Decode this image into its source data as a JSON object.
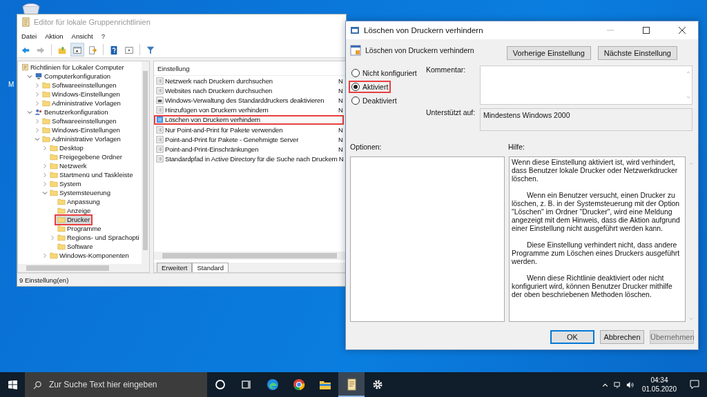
{
  "desktop": {
    "icons": [
      {
        "label": "M"
      }
    ]
  },
  "main_window": {
    "title": "Editor für lokale Gruppenrichtlinien",
    "menu": [
      "Datei",
      "Aktion",
      "Ansicht",
      "?"
    ],
    "toolbar": [
      {
        "kind": "back",
        "disabled": false,
        "selected": false
      },
      {
        "kind": "forward",
        "disabled": true,
        "selected": false
      },
      {
        "kind": "up",
        "disabled": false,
        "selected": false
      },
      {
        "kind": "tree",
        "disabled": false,
        "selected": true
      },
      {
        "kind": "export",
        "disabled": false,
        "selected": false
      },
      {
        "kind": "help",
        "disabled": false,
        "selected": false
      },
      {
        "kind": "pane",
        "disabled": false,
        "selected": false
      },
      {
        "kind": "filter",
        "disabled": false,
        "selected": false
      }
    ],
    "tree": [
      {
        "label": "Richtlinien für Lokaler Computer",
        "kind": "root",
        "selected": false,
        "highlighted": false,
        "children": [
          {
            "label": "Computerkonfiguration",
            "kind": "computer",
            "expanded": true,
            "selected": false,
            "highlighted": false,
            "children": [
              {
                "label": "Softwareeinstellungen",
                "kind": "folder",
                "expanded": false,
                "selected": false,
                "highlighted": false
              },
              {
                "label": "Windows-Einstellungen",
                "kind": "folder",
                "expanded": false,
                "selected": false,
                "highlighted": false
              },
              {
                "label": "Administrative Vorlagen",
                "kind": "folder",
                "expanded": false,
                "selected": false,
                "highlighted": false
              }
            ]
          },
          {
            "label": "Benutzerkonfiguration",
            "kind": "user",
            "expanded": true,
            "selected": false,
            "highlighted": false,
            "children": [
              {
                "label": "Softwareeinstellungen",
                "kind": "folder",
                "expanded": false,
                "selected": false,
                "highlighted": false
              },
              {
                "label": "Windows-Einstellungen",
                "kind": "folder",
                "expanded": false,
                "selected": false,
                "highlighted": false
              },
              {
                "label": "Administrative Vorlagen",
                "kind": "folder",
                "expanded": true,
                "selected": false,
                "highlighted": false,
                "children": [
                  {
                    "label": "Desktop",
                    "kind": "folder",
                    "expanded": false,
                    "selected": false,
                    "highlighted": false
                  },
                  {
                    "label": "Freigegebene Ordner",
                    "kind": "folder",
                    "selected": false,
                    "highlighted": false
                  },
                  {
                    "label": "Netzwerk",
                    "kind": "folder",
                    "expanded": false,
                    "selected": false,
                    "highlighted": false
                  },
                  {
                    "label": "Startmenü und Taskleiste",
                    "kind": "folder",
                    "expanded": false,
                    "selected": false,
                    "highlighted": false
                  },
                  {
                    "label": "System",
                    "kind": "folder",
                    "expanded": false,
                    "selected": false,
                    "highlighted": false
                  },
                  {
                    "label": "Systemsteuerung",
                    "kind": "folder",
                    "expanded": true,
                    "selected": false,
                    "highlighted": false,
                    "children": [
                      {
                        "label": "Anpassung",
                        "kind": "folder",
                        "selected": false,
                        "highlighted": false
                      },
                      {
                        "label": "Anzeige",
                        "kind": "folder",
                        "selected": false,
                        "highlighted": false
                      },
                      {
                        "label": "Drucker",
                        "kind": "folder",
                        "selected": true,
                        "highlighted": true
                      },
                      {
                        "label": "Programme",
                        "kind": "folder",
                        "selected": false,
                        "highlighted": false
                      },
                      {
                        "label": "Regions- und Sprachopti",
                        "kind": "folder",
                        "expanded": false,
                        "selected": false,
                        "highlighted": false
                      },
                      {
                        "label": "Software",
                        "kind": "folder",
                        "selected": false,
                        "highlighted": false
                      }
                    ]
                  },
                  {
                    "label": "Windows-Komponenten",
                    "kind": "folder",
                    "expanded": false,
                    "selected": false,
                    "highlighted": false
                  }
                ]
              }
            ]
          }
        ]
      }
    ],
    "list": {
      "header": "Einstellung",
      "rows": [
        {
          "label": "Netzwerk nach Druckern durchsuchen",
          "state": "N",
          "kind": "setting",
          "highlighted": false
        },
        {
          "label": "Websites nach Druckern durchsuchen",
          "state": "N",
          "kind": "setting",
          "highlighted": false
        },
        {
          "label": "Windows-Verwaltung des Standarddruckers deaktivieren",
          "state": "N",
          "kind": "printer",
          "highlighted": false
        },
        {
          "label": "Hinzufügen von Druckern verhindern",
          "state": "N",
          "kind": "setting",
          "highlighted": false
        },
        {
          "label": "Löschen von Druckern verhindern",
          "kind": "enabled",
          "highlighted": true
        },
        {
          "label": "Nur Point-and-Print für Pakete verwenden",
          "state": "N",
          "kind": "setting",
          "highlighted": false
        },
        {
          "label": "Point-and-Print für Pakete - Genehmigte Server",
          "state": "N",
          "kind": "setting",
          "highlighted": false
        },
        {
          "label": "Point-and-Print-Einschränkungen",
          "state": "N",
          "kind": "setting",
          "highlighted": false
        },
        {
          "label": "Standardpfad in Active Directory für die Suche nach Druckern",
          "state": "N",
          "kind": "setting",
          "highlighted": false
        }
      ]
    },
    "tabs": [
      {
        "label": "Erweitert",
        "selected": false
      },
      {
        "label": "Standard",
        "selected": true
      }
    ],
    "status_bar": "9 Einstellung(en)"
  },
  "dialog": {
    "title": "Löschen von Druckern verhindern",
    "heading": "Löschen von Druckern verhindern",
    "nav_buttons": [
      "Vorherige Einstellung",
      "Nächste Einstellung"
    ],
    "options": [
      {
        "label": "Nicht konfiguriert",
        "selected": false,
        "highlighted": false
      },
      {
        "label": "Aktiviert",
        "selected": true,
        "highlighted": true
      },
      {
        "label": "Deaktiviert",
        "selected": false,
        "highlighted": false
      }
    ],
    "comment_label": "Kommentar:",
    "supported_label": "Unterstützt auf:",
    "supported_value": "Mindestens Windows 2000",
    "options_label": "Optionen:",
    "help_label": "Hilfe:",
    "help": [
      "Wenn diese Einstellung aktiviert ist, wird verhindert, dass Benutzer lokale Drucker oder Netzwerkdrucker löschen.",
      "Wenn ein Benutzer versucht, einen Drucker zu löschen, z. B. in der Systemsteuerung mit der Option \"Löschen\" im Ordner \"Drucker\", wird eine Meldung angezeigt mit dem Hinweis, dass die Aktion aufgrund einer Einstellung nicht ausgeführt werden kann.",
      "Diese Einstellung verhindert nicht, dass andere Programme zum Löschen eines Druckers ausgeführt werden.",
      "Wenn diese Richtlinie deaktiviert oder nicht konfiguriert wird, können Benutzer Drucker mithilfe der oben beschriebenen Methoden löschen."
    ],
    "buttons": [
      {
        "label": "OK",
        "kind": "default",
        "disabled": false
      },
      {
        "label": "Abbrechen",
        "kind": "normal",
        "disabled": false
      },
      {
        "label": "Übernehmen",
        "kind": "normal",
        "disabled": true
      }
    ]
  },
  "taskbar": {
    "search_placeholder": "Zur Suche Text hier eingeben",
    "apps": [
      {
        "kind": "cortana",
        "selected": false
      },
      {
        "kind": "taskview",
        "selected": false
      },
      {
        "kind": "edge",
        "selected": false
      },
      {
        "kind": "chrome",
        "selected": false
      },
      {
        "kind": "explorer",
        "selected": false
      },
      {
        "kind": "gpedit",
        "selected": true
      },
      {
        "kind": "settings",
        "selected": false
      }
    ],
    "time": "04:34",
    "date": "01.05.2020"
  }
}
